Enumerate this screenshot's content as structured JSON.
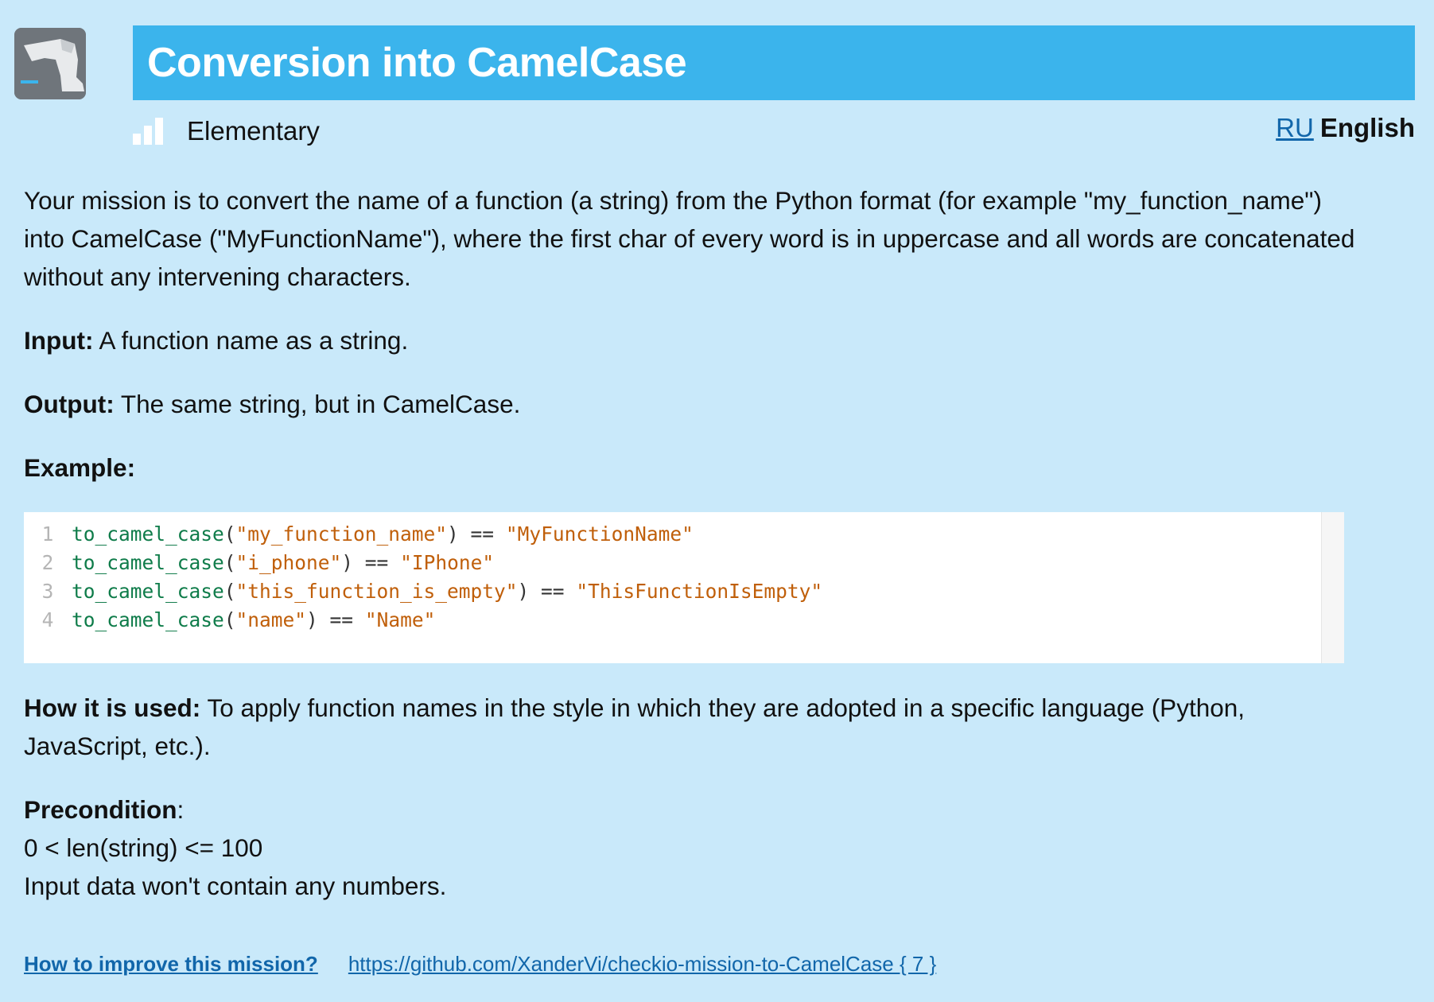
{
  "mission": {
    "title": "Conversion into CamelCase",
    "level": "Elementary"
  },
  "lang": {
    "ru": "RU",
    "current": "English"
  },
  "description": {
    "intro": "Your mission is to convert the name of a function (a string) from the Python format (for example \"my_function_name\") into CamelCase (\"MyFunctionName\"), where the first char of every word is in uppercase and all words are concatenated without any intervening characters.",
    "input_label": "Input:",
    "input_text": " A function name as a string.",
    "output_label": "Output:",
    "output_text": " The same string, but in CamelCase.",
    "example_label": "Example:"
  },
  "code": {
    "lines": [
      {
        "num": "1",
        "fn": "to_camel_case",
        "open": "(",
        "arg": "\"my_function_name\"",
        "mid": ") == ",
        "result": "\"MyFunctionName\""
      },
      {
        "num": "2",
        "fn": "to_camel_case",
        "open": "(",
        "arg": "\"i_phone\"",
        "mid": ") == ",
        "result": "\"IPhone\""
      },
      {
        "num": "3",
        "fn": "to_camel_case",
        "open": "(",
        "arg": "\"this_function_is_empty\"",
        "mid": ") == ",
        "result": "\"ThisFunctionIsEmpty\""
      },
      {
        "num": "4",
        "fn": "to_camel_case",
        "open": "(",
        "arg": "\"name\"",
        "mid": ") == ",
        "result": "\"Name\""
      }
    ]
  },
  "usage": {
    "label": "How it is used:",
    "text": " To apply function names in the style in which they are adopted in a specific language (Python, JavaScript, etc.)."
  },
  "precondition": {
    "label": "Precondition",
    "colon": ":",
    "line1": "0 < len(string) <= 100",
    "line2": "Input data won't contain any numbers."
  },
  "footer": {
    "improve_link": "How to improve this mission?",
    "repo_link": "https://github.com/XanderVi/checkio-mission-to-CamelCase { 7 }"
  },
  "icons": {
    "mission": "mission-icon",
    "level": "level-bars-icon"
  }
}
